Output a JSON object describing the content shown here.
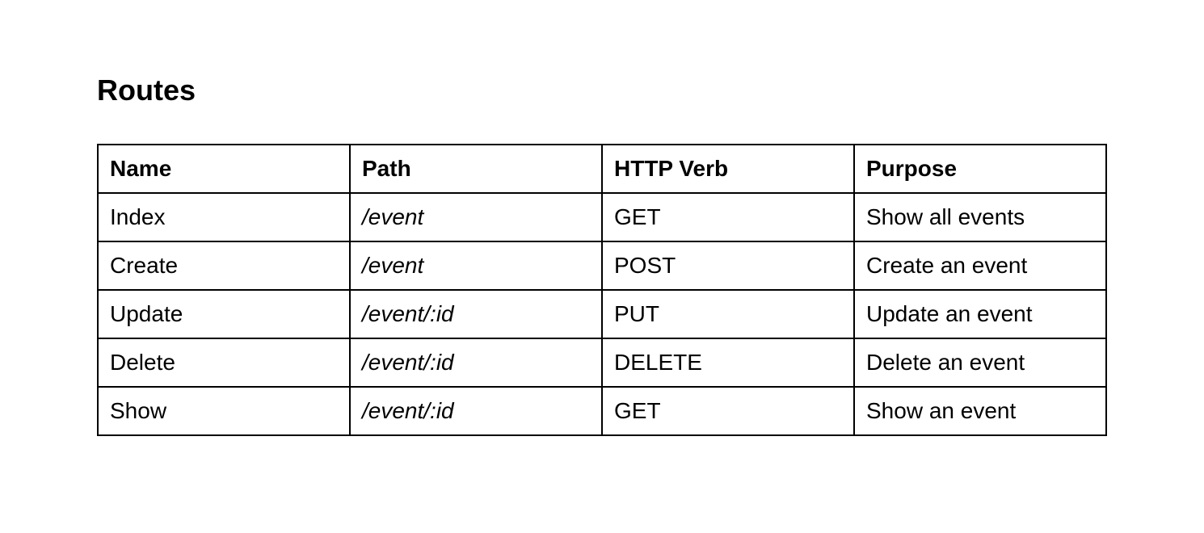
{
  "document": {
    "heading": "Routes"
  },
  "routes_table": {
    "headers": [
      "Name",
      "Path",
      "HTTP Verb",
      "Purpose"
    ],
    "rows": [
      {
        "name": "Index",
        "path": "/event",
        "verb": "GET",
        "purpose": "Show all events"
      },
      {
        "name": "Create",
        "path": "/event",
        "verb": "POST",
        "purpose": "Create an event"
      },
      {
        "name": "Update",
        "path": "/event/:id",
        "verb": "PUT",
        "purpose": "Update an event"
      },
      {
        "name": "Delete",
        "path": "/event/:id",
        "verb": "DELETE",
        "purpose": "Delete an event"
      },
      {
        "name": "Show",
        "path": "/event/:id",
        "verb": "GET",
        "purpose": "Show an event"
      }
    ]
  }
}
